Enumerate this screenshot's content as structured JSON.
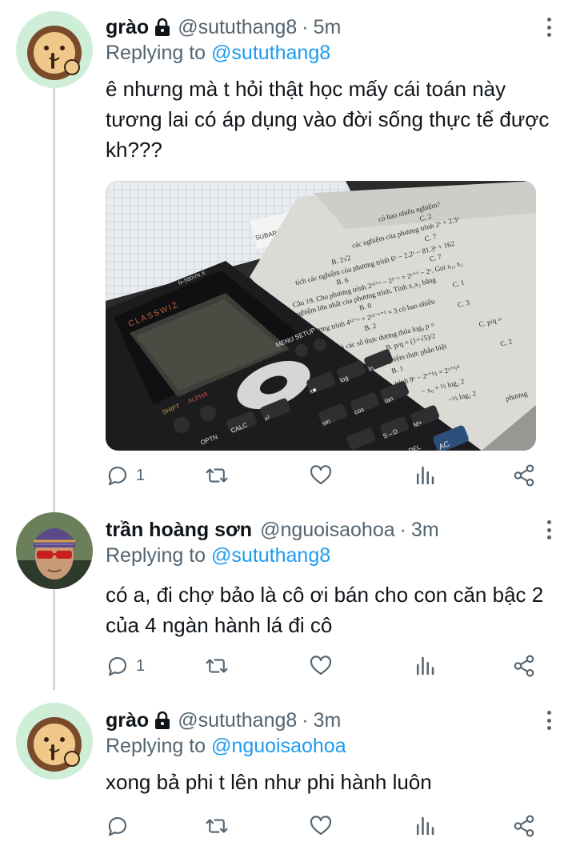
{
  "tweets": [
    {
      "name": "grào",
      "locked": true,
      "handle": "@sututhang8",
      "time": "5m",
      "replying_prefix": "Replying to",
      "replying_to": "@sututhang8",
      "text": "ê nhưng mà t hỏi thật học mấy cái toán này tương lai có áp dụng vào đời sống thực tế được kh???",
      "has_media": true,
      "reply_count": "1"
    },
    {
      "name": "trần hoàng sơn",
      "locked": false,
      "handle": "@nguoisaohoa",
      "time": "3m",
      "replying_prefix": "Replying to",
      "replying_to": "@sututhang8",
      "text": "có a, đi chợ bảo là cô ơi bán cho con căn bậc 2 của 4 ngàn hành lá đi cô",
      "has_media": false,
      "reply_count": "1"
    },
    {
      "name": "grào",
      "locked": true,
      "handle": "@sututhang8",
      "time": "3m",
      "replying_prefix": "Replying to",
      "replying_to": "@nguoisaohoa",
      "text": "xong bả phi t lên như phi hành luôn",
      "has_media": false,
      "reply_count": ""
    }
  ],
  "media": {
    "calculator_brand": "CLASSWIZ",
    "calculator_model": "fx-580VN X",
    "notebook_brand": "SUBARU",
    "paper_lines": [
      "có bao nhiêu nghiệm?",
      "C. 2",
      "các nghiệm của phương trình 2ˣ + 2.3ˣ",
      "B. 2√2",
      "C. 7",
      "tích các nghiệm của phương trình 6ˣ − 2.2ˣ − 81.3ˣ + 162",
      "B. 6",
      "C. 7",
      "Câu 19. Cho phương trình 2ˣ²⁺ˣ − 2¹⁻ˣ = 2ˣ⁺¹ − 2ˣ. Gọi x₁, x₂",
      "nghiệm lớn nhất của phương trình. Tính x₁x₂ bằng",
      "B. 0",
      "C. 1",
      "Phương trình 4ˣ²⁻ˣ + 2ˣ²⁻ˣ⁺¹ = 3 có bao nhiêu",
      "B. 2",
      "C. 3",
      "Cho p, q là các số thực dương thỏa log₉ p =",
      "B. p/q = (1+√5)/2",
      "C. p/q =",
      "Hà Nội) Số nghiệm thực phân biệt",
      "B. 1",
      "C. 2",
      "trình 9ˣ − 2ˣ⁺½ = 2ˣ⁺³/²",
      "− x₀ + ½ log₂ 2",
      "−½ log₂ 2",
      "phương"
    ],
    "keys": [
      "SHIFT",
      "ALPHA",
      "MENU SETUP",
      "OPTN",
      "CALC",
      "x²",
      "x■",
      "log",
      "ln",
      "sin",
      "cos",
      "tan",
      "S⇔D",
      "M+",
      "AC",
      "DEL"
    ]
  },
  "colors": {
    "link": "#1d9bf0",
    "secondary": "#536471",
    "thread_line": "#cfd9de"
  }
}
